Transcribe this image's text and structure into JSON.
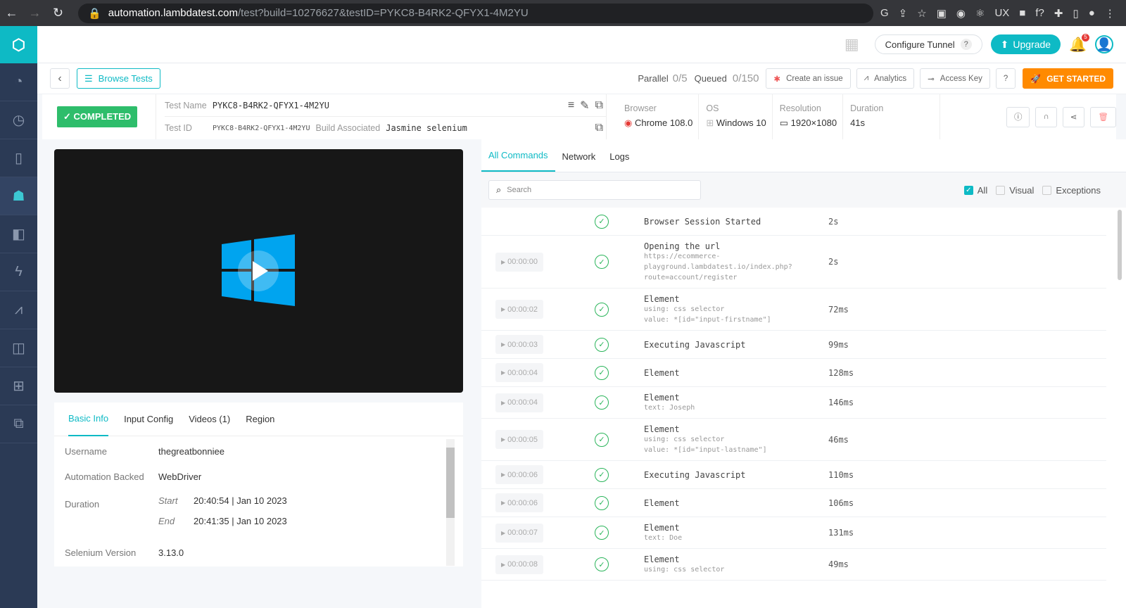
{
  "browser": {
    "url_host": "automation.lambdatest.com",
    "url_path": "/test?build=10276627&testID=PYKC8-B4RK2-QFYX1-4M2YU"
  },
  "header": {
    "configure_tunnel": "Configure Tunnel",
    "help": "?",
    "upgrade": "Upgrade",
    "notif_count": "5"
  },
  "toolbar": {
    "browse_tests": "Browse Tests",
    "parallel_label": "Parallel",
    "parallel_value": "0/5",
    "queued_label": "Queued",
    "queued_value": "0/150",
    "create_issue": "Create an issue",
    "analytics": "Analytics",
    "access_key": "Access Key",
    "help": "?",
    "get_started": "GET STARTED"
  },
  "test": {
    "status": "COMPLETED",
    "name_label": "Test Name",
    "name": "PYKC8-B4RK2-QFYX1-4M2YU",
    "id_label": "Test ID",
    "id": "PYKC8-B4RK2-QFYX1-4M2YU",
    "build_label": "Build Associated",
    "build": "Jasmine selenium",
    "browser_label": "Browser",
    "browser": "Chrome 108.0",
    "os_label": "OS",
    "os": "Windows 10",
    "resolution_label": "Resolution",
    "resolution": "1920×1080",
    "duration_label": "Duration",
    "duration": "41s"
  },
  "info_tabs": [
    "Basic Info",
    "Input Config",
    "Videos (1)",
    "Region"
  ],
  "basic_info": {
    "username_label": "Username",
    "username": "thegreatbonniee",
    "automation_label": "Automation Backed",
    "automation": "WebDriver",
    "duration_label": "Duration",
    "start_label": "Start",
    "start": "20:40:54 | Jan 10 2023",
    "end_label": "End",
    "end": "20:41:35 | Jan 10 2023",
    "selenium_label": "Selenium Version",
    "selenium": "3.13.0"
  },
  "cmd_tabs": [
    "All Commands",
    "Network",
    "Logs"
  ],
  "search": {
    "placeholder": "Search"
  },
  "filters": {
    "all": "All",
    "visual": "Visual",
    "exceptions": "Exceptions"
  },
  "commands": [
    {
      "time": "",
      "title": "Browser Session Started",
      "detail": "",
      "duration": "2s"
    },
    {
      "time": "00:00:00",
      "title": "Opening the url",
      "detail": "https://ecommerce-playground.lambdatest.io/index.php?route=account/register",
      "duration": "2s"
    },
    {
      "time": "00:00:02",
      "title": "Element",
      "detail": "using: css selector\nvalue: *[id=\"input-firstname\"]",
      "duration": "72ms"
    },
    {
      "time": "00:00:03",
      "title": "Executing Javascript",
      "detail": "",
      "duration": "99ms"
    },
    {
      "time": "00:00:04",
      "title": "Element",
      "detail": "",
      "duration": "128ms"
    },
    {
      "time": "00:00:04",
      "title": "Element",
      "detail": "text: Joseph",
      "duration": "146ms"
    },
    {
      "time": "00:00:05",
      "title": "Element",
      "detail": "using: css selector\nvalue: *[id=\"input-lastname\"]",
      "duration": "46ms"
    },
    {
      "time": "00:00:06",
      "title": "Executing Javascript",
      "detail": "",
      "duration": "110ms"
    },
    {
      "time": "00:00:06",
      "title": "Element",
      "detail": "",
      "duration": "106ms"
    },
    {
      "time": "00:00:07",
      "title": "Element",
      "detail": "text: Doe",
      "duration": "131ms"
    },
    {
      "time": "00:00:08",
      "title": "Element",
      "detail": "using: css selector",
      "duration": "49ms"
    }
  ]
}
